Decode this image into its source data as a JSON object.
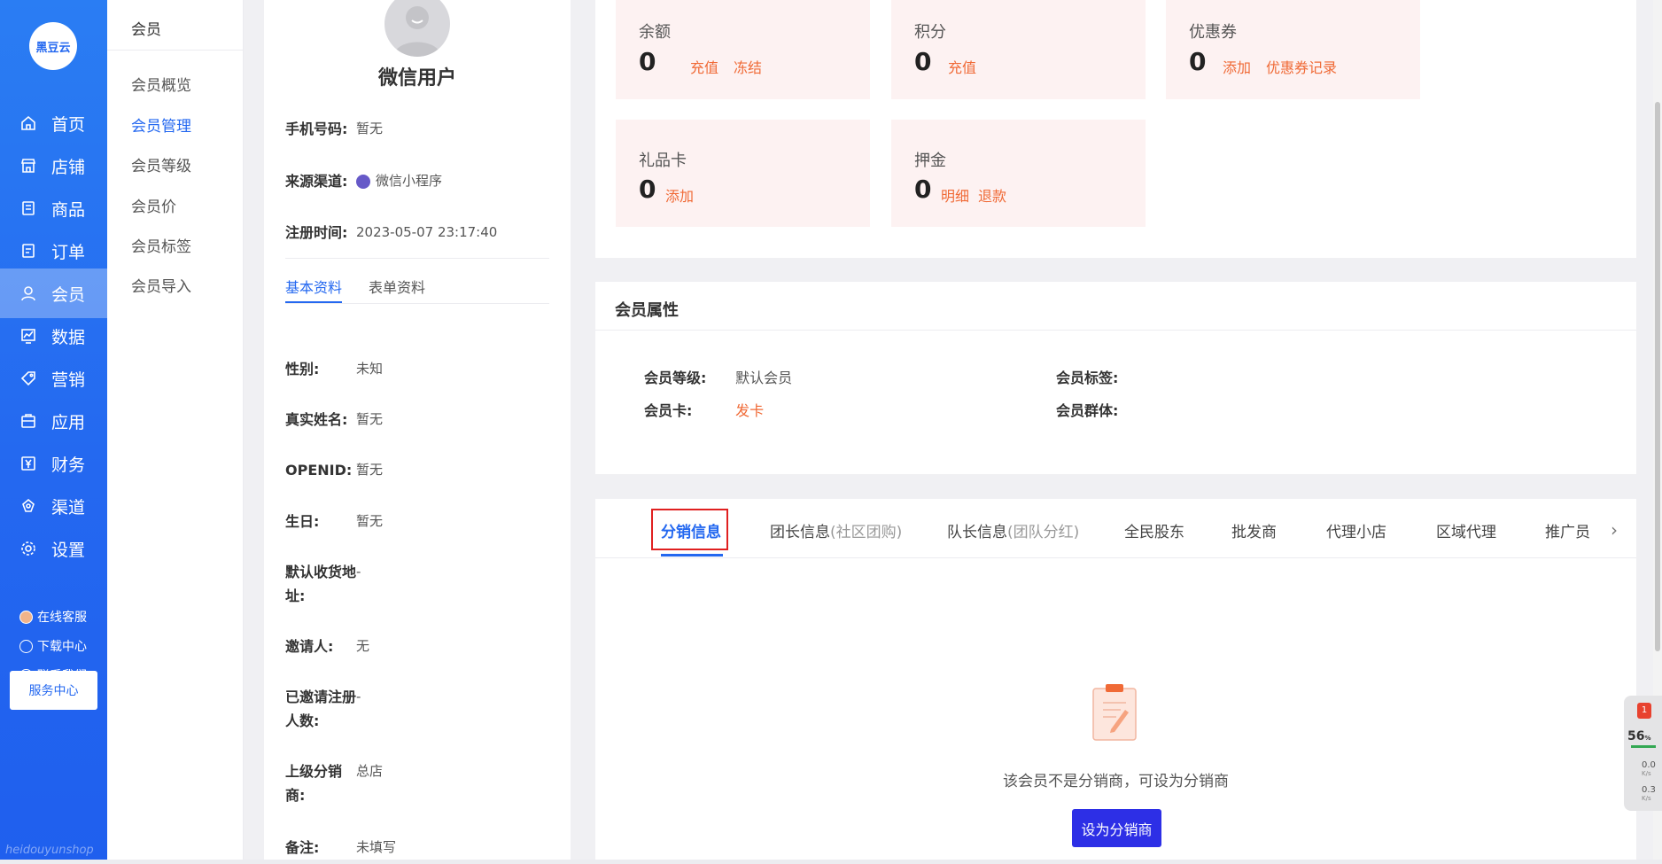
{
  "nav": {
    "logo_text": "黑豆云",
    "items": [
      {
        "label": "首页",
        "icon": "home-icon"
      },
      {
        "label": "店铺",
        "icon": "store-icon"
      },
      {
        "label": "商品",
        "icon": "goods-icon"
      },
      {
        "label": "订单",
        "icon": "order-icon"
      },
      {
        "label": "会员",
        "icon": "user-icon"
      },
      {
        "label": "数据",
        "icon": "chart-icon"
      },
      {
        "label": "营销",
        "icon": "tag-icon"
      },
      {
        "label": "应用",
        "icon": "app-icon"
      },
      {
        "label": "财务",
        "icon": "yen-icon"
      },
      {
        "label": "渠道",
        "icon": "channel-icon"
      },
      {
        "label": "设置",
        "icon": "gear-icon"
      }
    ],
    "active": "会员",
    "service_center": "服务中心",
    "links": [
      "在线客服",
      "下载中心",
      "联系我们"
    ],
    "brand": "heidouyunshop"
  },
  "subnav": {
    "title": "会员",
    "items": [
      "会员概览",
      "会员管理",
      "会员等级",
      "会员价",
      "会员标签",
      "会员导入"
    ],
    "active": "会员管理"
  },
  "profile": {
    "name": "微信用户",
    "phone_label": "手机号码:",
    "phone": "暂无",
    "source_label": "来源渠道:",
    "source": "微信小程序",
    "reg_label": "注册时间:",
    "reg_time": "2023-05-07 23:17:40",
    "tabs": [
      "基本资料",
      "表单资料"
    ],
    "fields": [
      {
        "label": "性别:",
        "value": "未知"
      },
      {
        "label": "真实姓名:",
        "value": "暂无"
      },
      {
        "label": "OPENID:",
        "value": "暂无"
      },
      {
        "label": "生日:",
        "value": "暂无"
      },
      {
        "label": "默认收货地址:",
        "value": "-"
      },
      {
        "label": "邀请人:",
        "value": "无"
      },
      {
        "label": "已邀请注册人数:",
        "value": "-"
      },
      {
        "label": "上级分销商:",
        "value": "总店"
      },
      {
        "label": "备注:",
        "value": "未填写"
      }
    ]
  },
  "assets": {
    "balance": {
      "title": "余额",
      "value": "0",
      "links": [
        "充值",
        "冻结"
      ]
    },
    "points": {
      "title": "积分",
      "value": "0",
      "links": [
        "充值"
      ]
    },
    "coupons": {
      "title": "优惠券",
      "value": "0",
      "links": [
        "添加",
        "优惠券记录"
      ]
    },
    "giftcard": {
      "title": "礼品卡",
      "value": "0",
      "links": [
        "添加"
      ]
    },
    "deposit": {
      "title": "押金",
      "value": "0",
      "links": [
        "明细",
        "退款"
      ]
    }
  },
  "attrs": {
    "title": "会员属性",
    "level_label": "会员等级:",
    "level": "默认会员",
    "card_label": "会员卡:",
    "card_action": "发卡",
    "tags_label": "会员标签:",
    "group_label": "会员群体:"
  },
  "dist": {
    "tabs": [
      {
        "label": "分销信息",
        "sub": ""
      },
      {
        "label": "团长信息",
        "sub": "(社区团购)"
      },
      {
        "label": "队长信息",
        "sub": "(团队分红)"
      },
      {
        "label": "全民股东",
        "sub": ""
      },
      {
        "label": "批发商",
        "sub": ""
      },
      {
        "label": "代理小店",
        "sub": ""
      },
      {
        "label": "区域代理",
        "sub": ""
      },
      {
        "label": "推广员",
        "sub": ""
      }
    ],
    "active": "分销信息",
    "empty_text": "该会员不是分销商，可设为分销商",
    "button": "设为分销商"
  },
  "widget": {
    "badge": "1",
    "percent": "56",
    "percent_unit": "%",
    "up": "0.0",
    "down": "0.3",
    "unit": "K/s"
  },
  "colors": {
    "nav_blue": "#2468f0",
    "accent_orange": "#f06a36",
    "card_bg": "#fdf2f2",
    "button_blue": "#2d2fe6",
    "highlight_red": "#e02020"
  }
}
